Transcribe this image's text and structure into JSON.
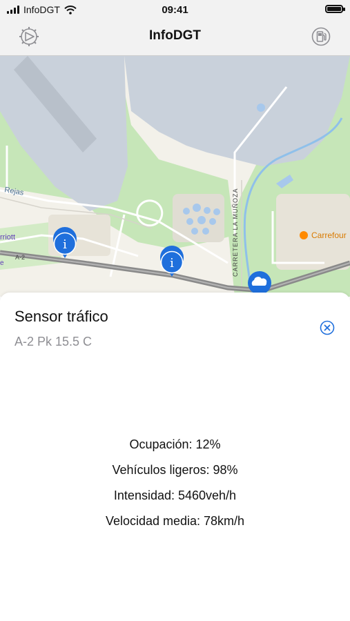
{
  "status_bar": {
    "carrier": "InfoDGT",
    "time": "09:41"
  },
  "nav": {
    "title": "InfoDGT",
    "left_icon": "compass-icon",
    "right_icon": "fuel-station-icon"
  },
  "map": {
    "labels": {
      "rejas": "Rejas",
      "marriott": "rriott",
      "a2_left": "A-2",
      "carretera": "CARRETERA LA MUÑOZA",
      "carrefour": "Carrefour",
      "edge_e": "e"
    },
    "markers": [
      "info-marker",
      "info-marker",
      "weather-marker"
    ],
    "colors": {
      "water": "#c9d1db",
      "green": "#c6e6b8",
      "highway": "#8a8a8a",
      "marker": "#1f6fdc"
    }
  },
  "detail": {
    "title": "Sensor tráfico",
    "subtitle": "A-2 Pk 15.5 C",
    "stats": {
      "occupancy": "Ocupación: 12%",
      "light_vehicles": "Vehículos ligeros: 98%",
      "intensity": "Intensidad: 5460veh/h",
      "avg_speed": "Velocidad media: 78km/h"
    }
  }
}
